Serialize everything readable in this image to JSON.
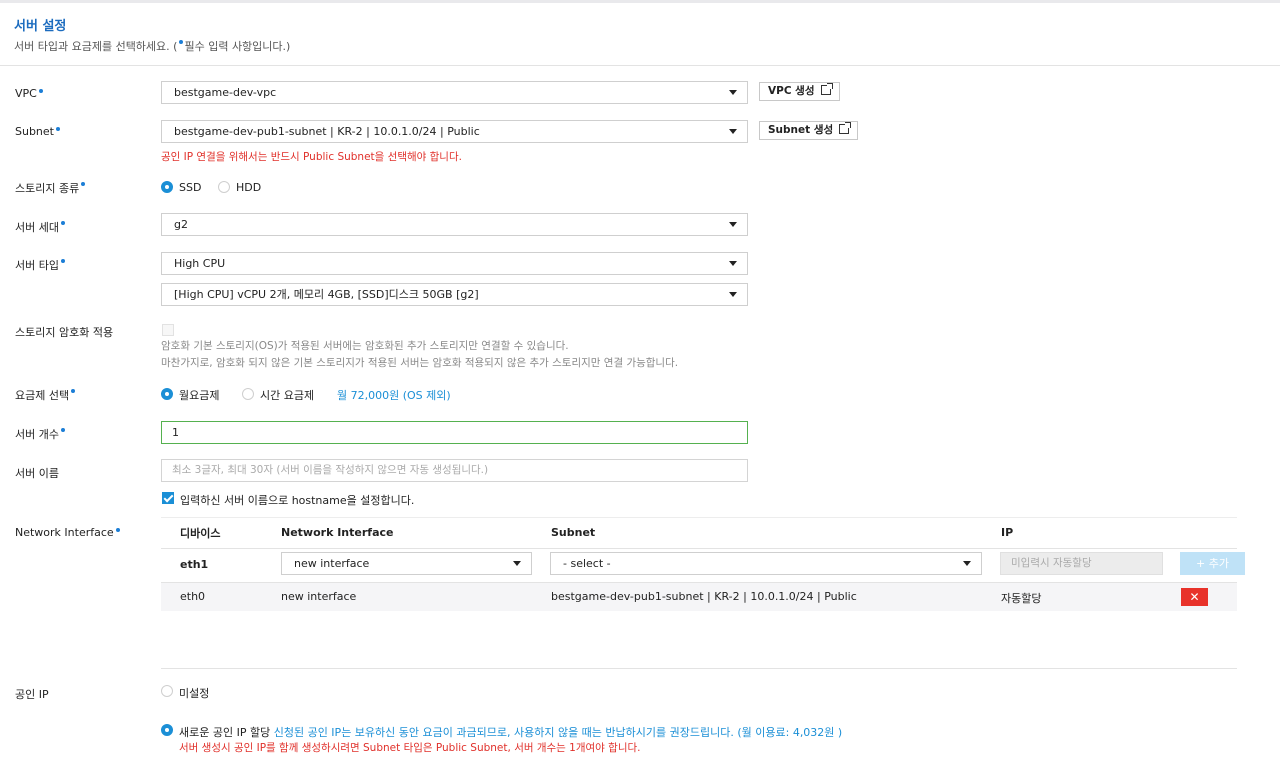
{
  "header": {
    "title": "서버 설정",
    "subtitle_pre": "서버 타입과 요금제를 선택하세요. (",
    "subtitle_post": "필수 입력 사항입니다.)"
  },
  "vpc": {
    "label": "VPC",
    "value": "bestgame-dev-vpc",
    "button": "VPC 생성"
  },
  "subnet": {
    "label": "Subnet",
    "value": "bestgame-dev-pub1-subnet | KR-2 | 10.0.1.0/24 | Public",
    "button": "Subnet 생성",
    "warning": "공인 IP 연결을 위해서는 반드시 Public Subnet을 선택해야 합니다."
  },
  "storage_type": {
    "label": "스토리지 종류",
    "options": [
      "SSD",
      "HDD"
    ],
    "selected": "SSD"
  },
  "server_gen": {
    "label": "서버 세대",
    "value": "g2"
  },
  "server_type": {
    "label": "서버 타입",
    "value": "High CPU",
    "spec": "[High CPU] vCPU 2개, 메모리 4GB, [SSD]디스크 50GB [g2]"
  },
  "encryption": {
    "label": "스토리지 암호화 적용",
    "checked": false,
    "note1": "암호화 기본 스토리지(OS)가 적용된 서버에는 암호화된 추가 스토리지만 연결할 수 있습니다.",
    "note2": "마찬가지로, 암호화 되지 않은 기본 스토리지가 적용된 서버는 암호화 적용되지 않은 추가 스토리지만 연결 가능합니다."
  },
  "pricing": {
    "label": "요금제 선택",
    "options": [
      "월요금제",
      "시간 요금제"
    ],
    "selected": "월요금제",
    "price": "월 72,000원 (OS 제외)"
  },
  "server_count": {
    "label": "서버 개수",
    "value": "1"
  },
  "server_name": {
    "label": "서버 이름",
    "placeholder": "최소 3글자, 최대 30자 (서버 이름을 작성하지 않으면 자동 생성됩니다.)",
    "hostname_checkbox": "입력하신 서버 이름으로 hostname을 설정합니다.",
    "hostname_checked": true
  },
  "network_interface": {
    "label": "Network Interface",
    "columns": [
      "디바이스",
      "Network Interface",
      "Subnet",
      "IP"
    ],
    "edit_row": {
      "device": "eth1",
      "interface": "new interface",
      "subnet": "- select -",
      "ip_placeholder": "미입력시 자동할당",
      "add_button": "+ 추가"
    },
    "rows": [
      {
        "device": "eth0",
        "interface": "new interface",
        "subnet": "bestgame-dev-pub1-subnet | KR-2 | 10.0.1.0/24 | Public",
        "ip": "자동할당",
        "delete": "✕"
      }
    ]
  },
  "public_ip": {
    "label": "공인 IP",
    "option_none": "미설정",
    "option_new": "새로운 공인 IP 할당",
    "option_new_note": "신청된 공인 IP는 보유하신 동안 요금이 과금되므로, 사용하지 않을 때는 반납하시기를 권장드립니다. (월 이용료: 4,032원 )",
    "warning": "서버 생성시 공인 IP를 함께 생성하시려면 Subnet 타입은 Public Subnet, 서버 개수는 1개여야 합니다.",
    "selected": "new"
  },
  "colors": {
    "accent": "#1b8fd6",
    "title": "#1c6cbf",
    "warning": "#e0302a",
    "active_border": "#55b14f",
    "delete": "#e8322a",
    "add_button": "#bfe2f7"
  }
}
